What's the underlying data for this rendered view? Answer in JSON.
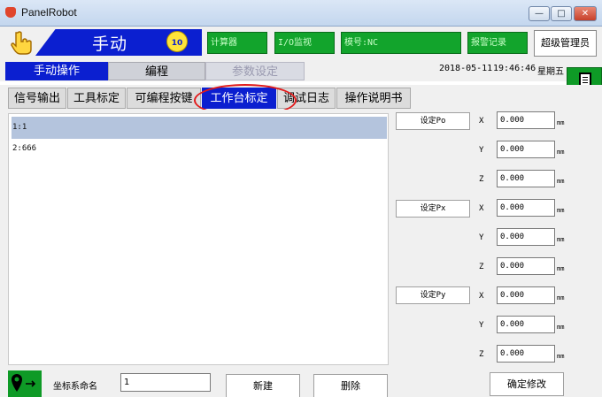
{
  "window": {
    "title": "PanelRobot",
    "min_glyph": "—",
    "max_glyph": "□",
    "close_glyph": "✕"
  },
  "topbar": {
    "mode": "手动",
    "speed": "10",
    "status_boxes": [
      "计算器",
      "I/O监视",
      "模号:NC",
      "报警记录"
    ],
    "admin_button": "超级管理员"
  },
  "tabs": [
    {
      "label": "手动操作"
    },
    {
      "label": "编程"
    },
    {
      "label": "参数设定"
    }
  ],
  "datetime": {
    "date": "2018-05-11",
    "time": "19:46:46",
    "weekday": "星期五"
  },
  "subtabs": [
    {
      "label": "信号输出"
    },
    {
      "label": "工具标定"
    },
    {
      "label": "可编程按键"
    },
    {
      "label": "工作台标定"
    },
    {
      "label": "调试日志"
    },
    {
      "label": "操作说明书"
    }
  ],
  "list": [
    {
      "label": "1:1"
    },
    {
      "label": "2:666"
    }
  ],
  "calibration": {
    "set_buttons": [
      "设定Po",
      "设定Px",
      "设定Py"
    ],
    "axes": [
      "X",
      "Y",
      "Z",
      "X",
      "Y",
      "Z",
      "X",
      "Y",
      "Z"
    ],
    "values": [
      "0.000",
      "0.000",
      "0.000",
      "0.000",
      "0.000",
      "0.000",
      "0.000",
      "0.000",
      "0.000"
    ],
    "unit": "mm"
  },
  "bottom": {
    "name_label": "坐标系命名",
    "name_value": "1",
    "new_button": "新建",
    "delete_button": "删除",
    "confirm_button": "确定修改"
  }
}
